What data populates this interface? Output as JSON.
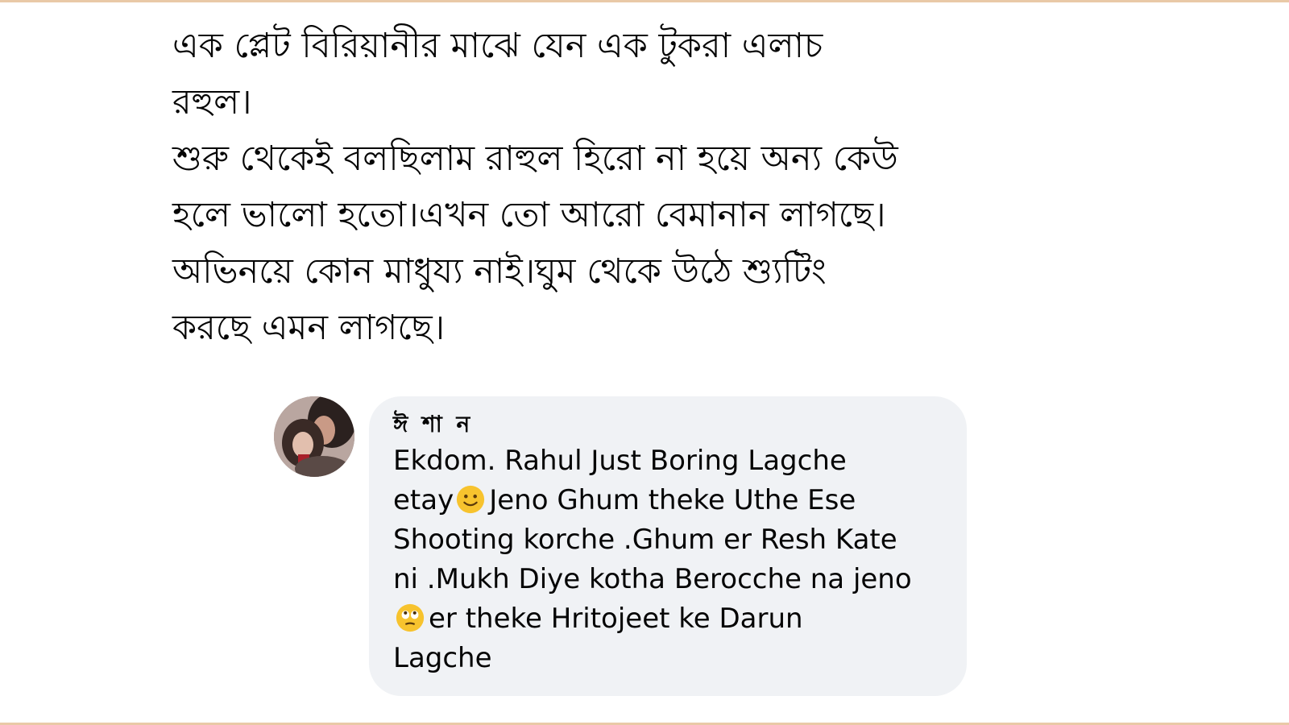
{
  "post": {
    "lines": [
      "এক প্লেট বিরিয়ানীর মাঝে যেন এক টুকরা এলাচ",
      "রহুল।",
      "শুরু থেকেই বলছিলাম রাহুল হিরো না হয়ে অন্য কেউ",
      "হলে ভালো হতো।এখন তো আরো বেমানান লাগছে।",
      "অভিনয়ে কোন মাধুয্য নাই।ঘুম থেকে উঠে শ্যুটিং",
      "করছে এমন লাগছে।"
    ]
  },
  "comment": {
    "author": "ঈ শা ন",
    "lines": [
      "Ekdom. Rahul Just Boring Lagche",
      "etay",
      "Jeno Ghum theke Uthe Ese",
      "Shooting korche .Ghum er Resh Kate",
      "ni .Mukh Diye kotha Berocche na jeno",
      "er theke Hritojeet ke Darun",
      "Lagche"
    ],
    "emojis": [
      "slightly-smiling-face-icon",
      "face-with-rolling-eyes-icon"
    ]
  },
  "colors": {
    "text": "#050505",
    "bubble": "#f0f2f5",
    "frame": "#e9c9a7",
    "emoji": "#f7c32e"
  }
}
